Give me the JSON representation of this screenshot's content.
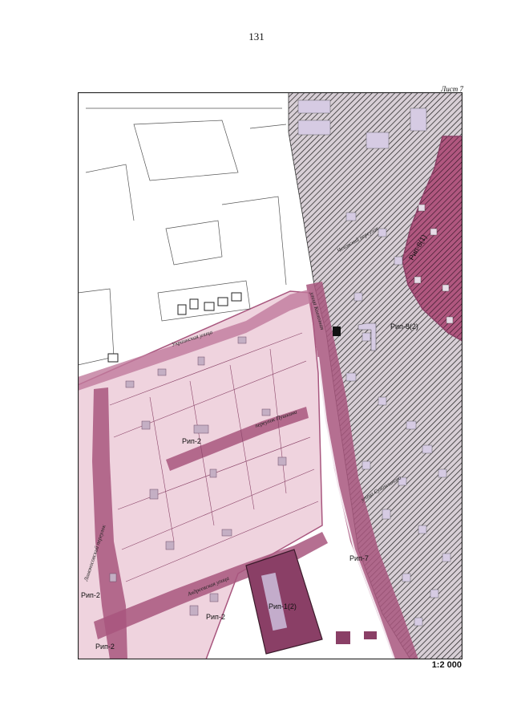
{
  "page": {
    "number": "131",
    "sheet": "Лист 7",
    "scale": "1:2 000"
  },
  "colors": {
    "zone_pink": "#e8b8cc",
    "zone_purple": "#a8567e",
    "zone_dark": "#8a3f66",
    "hatch_bg": "#d8cfd6",
    "frame": "#222222"
  },
  "streets": {
    "ukrainian": "Украинская улица",
    "kolkhoznaya": "улица Колхозная",
    "pushkin_lane": "переулок Пушкина",
    "lomonosov_lane": "Ломоносовский переулок",
    "andreevskaya": "Андреевская улица",
    "chekhov_lane": "Чеховский переулок",
    "sukhomlinova": "улица Сухомлинова"
  },
  "zones": {
    "rip2_center": "Рип-2",
    "rip2_left": "Рип-2",
    "rip2_bottom": "Рип-2",
    "rip2_bottom_left": "Рип-2",
    "rip1_2": "Рип-1(2)",
    "rip7": "Рип-7",
    "rip8_1": "Рип-8(1)",
    "rip8_2": "Рип-8(2)"
  }
}
